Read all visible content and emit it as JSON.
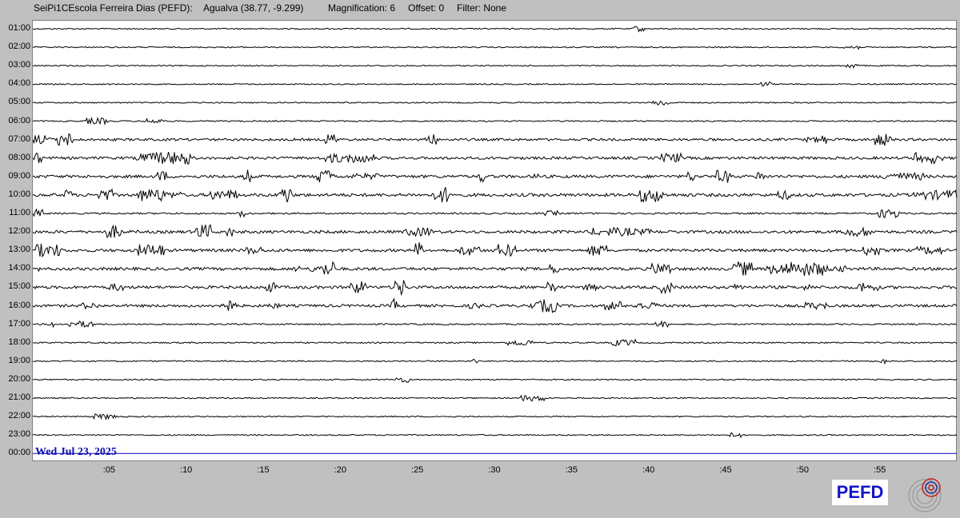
{
  "header": {
    "station": "SeiPi1CEscola Ferreira Dias (PEFD):",
    "location": "Agualva (38.77, -9.299)",
    "magnification": "Magnification: 6",
    "offset": "Offset: 0",
    "filter": "Filter: None"
  },
  "chart_data": {
    "type": "line",
    "title": "",
    "hours": [
      "01:00",
      "02:00",
      "03:00",
      "04:00",
      "05:00",
      "06:00",
      "07:00",
      "08:00",
      "09:00",
      "10:00",
      "11:00",
      "12:00",
      "13:00",
      "14:00",
      "15:00",
      "16:00",
      "17:00",
      "18:00",
      "19:00",
      "20:00",
      "21:00",
      "22:00",
      "23:00",
      "00:00"
    ],
    "minute_ticks": [
      ":05",
      ":10",
      ":15",
      ":20",
      ":25",
      ":30",
      ":35",
      ":40",
      ":45",
      ":50",
      ":55"
    ],
    "minute_values": [
      5,
      10,
      15,
      20,
      25,
      30,
      35,
      40,
      45,
      50,
      55
    ],
    "xlim": [
      0,
      60
    ],
    "date_label": "Wed Jul 23, 2025",
    "trace_color": "#000000",
    "current_trace_color": "#0000c0",
    "activity": [
      {
        "hour": "01:00",
        "level": 0.1
      },
      {
        "hour": "02:00",
        "level": 0.1
      },
      {
        "hour": "03:00",
        "level": 0.1
      },
      {
        "hour": "04:00",
        "level": 0.1
      },
      {
        "hour": "05:00",
        "level": 0.1
      },
      {
        "hour": "06:00",
        "level": 0.15
      },
      {
        "hour": "07:00",
        "level": 0.6
      },
      {
        "hour": "08:00",
        "level": 0.7
      },
      {
        "hour": "09:00",
        "level": 0.8
      },
      {
        "hour": "10:00",
        "level": 0.9
      },
      {
        "hour": "11:00",
        "level": 0.3
      },
      {
        "hour": "12:00",
        "level": 0.8
      },
      {
        "hour": "13:00",
        "level": 0.8
      },
      {
        "hour": "14:00",
        "level": 0.8
      },
      {
        "hour": "15:00",
        "level": 0.8
      },
      {
        "hour": "16:00",
        "level": 0.7
      },
      {
        "hour": "17:00",
        "level": 0.2
      },
      {
        "hour": "18:00",
        "level": 0.15
      },
      {
        "hour": "19:00",
        "level": 0.12
      },
      {
        "hour": "20:00",
        "level": 0.1
      },
      {
        "hour": "21:00",
        "level": 0.1
      },
      {
        "hour": "22:00",
        "level": 0.1
      },
      {
        "hour": "23:00",
        "level": 0.1
      },
      {
        "hour": "00:00",
        "level": 0.0
      }
    ]
  },
  "logo": {
    "text": "PEFD",
    "color": "#1515c8"
  }
}
